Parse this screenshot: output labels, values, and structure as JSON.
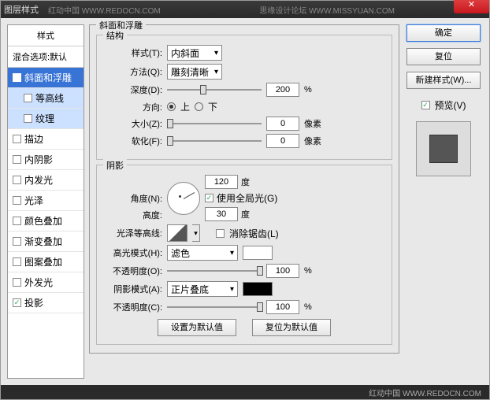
{
  "title": "图层样式",
  "watermark1": "红动中国  WWW.REDOCN.COM",
  "watermark2": "思缘设计论坛  WWW.MISSYUAN.COM",
  "sidebar": {
    "header": "样式",
    "blending": "混合选项:默认",
    "items": [
      {
        "label": "斜面和浮雕",
        "checked": true,
        "selected": true
      },
      {
        "label": "等高线",
        "checked": false,
        "sub": true,
        "hl": true
      },
      {
        "label": "纹理",
        "checked": false,
        "sub": true,
        "hl": true
      },
      {
        "label": "描边",
        "checked": false
      },
      {
        "label": "内阴影",
        "checked": false
      },
      {
        "label": "内发光",
        "checked": false
      },
      {
        "label": "光泽",
        "checked": false
      },
      {
        "label": "颜色叠加",
        "checked": false
      },
      {
        "label": "渐变叠加",
        "checked": false
      },
      {
        "label": "图案叠加",
        "checked": false
      },
      {
        "label": "外发光",
        "checked": false
      },
      {
        "label": "投影",
        "checked": true
      }
    ]
  },
  "main": {
    "group_title": "斜面和浮雕",
    "structure": {
      "title": "结构",
      "style_label": "样式(T):",
      "style_value": "内斜面",
      "technique_label": "方法(Q):",
      "technique_value": "雕刻清晰",
      "depth_label": "深度(D):",
      "depth_value": "200",
      "depth_unit": "%",
      "depth_pct": 35,
      "direction_label": "方向:",
      "up": "上",
      "down": "下",
      "size_label": "大小(Z):",
      "size_value": "0",
      "size_unit": "像素",
      "size_pct": 0,
      "soften_label": "软化(F):",
      "soften_value": "0",
      "soften_unit": "像素",
      "soften_pct": 0
    },
    "shading": {
      "title": "阴影",
      "angle_label": "角度(N):",
      "angle_value": "120",
      "angle_unit": "度",
      "global_label": "使用全局光(G)",
      "altitude_label": "高度:",
      "altitude_value": "30",
      "altitude_unit": "度",
      "gloss_label": "光泽等高线:",
      "antialias_label": "消除锯齿(L)",
      "highlight_label": "高光模式(H):",
      "highlight_value": "滤色",
      "highlight_color": "#ffffff",
      "highlight_op_label": "不透明度(O):",
      "highlight_op_value": "100",
      "highlight_op_unit": "%",
      "highlight_op_pct": 100,
      "shadow_label": "阴影模式(A):",
      "shadow_value": "正片叠底",
      "shadow_color": "#000000",
      "shadow_op_label": "不透明度(C):",
      "shadow_op_value": "100",
      "shadow_op_unit": "%",
      "shadow_op_pct": 100
    },
    "set_default": "设置为默认值",
    "reset_default": "复位为默认值"
  },
  "buttons": {
    "ok": "确定",
    "cancel": "复位",
    "new_style": "新建样式(W)...",
    "preview": "预览(V)"
  },
  "footer": "红动中国  WWW.REDOCN.COM"
}
